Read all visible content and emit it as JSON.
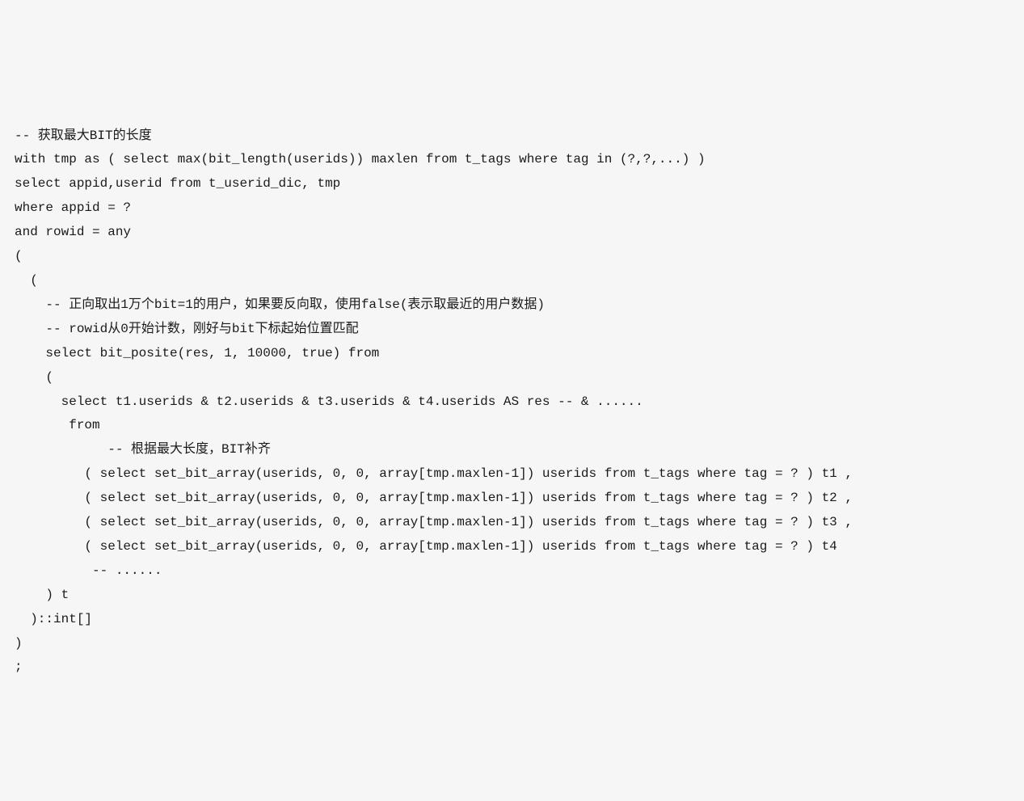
{
  "code": {
    "lines": [
      "-- 获取最大BIT的长度",
      "with tmp as ( select max(bit_length(userids)) maxlen from t_tags where tag in (?,?,...) )",
      "select appid,userid from t_userid_dic, tmp",
      "where appid = ?",
      "and rowid = any",
      "(",
      "  (",
      "    -- 正向取出1万个bit=1的用户，如果要反向取，使用false(表示取最近的用户数据)",
      "    -- rowid从0开始计数，刚好与bit下标起始位置匹配",
      "    select bit_posite(res, 1, 10000, true) from",
      "    (",
      "      select t1.userids & t2.userids & t3.userids & t4.userids AS res -- & ......",
      "       from",
      "            -- 根据最大长度，BIT补齐",
      "         ( select set_bit_array(userids, 0, 0, array[tmp.maxlen-1]) userids from t_tags where tag = ? ) t1 ,",
      "         ( select set_bit_array(userids, 0, 0, array[tmp.maxlen-1]) userids from t_tags where tag = ? ) t2 ,",
      "         ( select set_bit_array(userids, 0, 0, array[tmp.maxlen-1]) userids from t_tags where tag = ? ) t3 ,",
      "         ( select set_bit_array(userids, 0, 0, array[tmp.maxlen-1]) userids from t_tags where tag = ? ) t4",
      "          -- ......",
      "    ) t",
      "  )::int[]",
      ")",
      ";"
    ]
  }
}
